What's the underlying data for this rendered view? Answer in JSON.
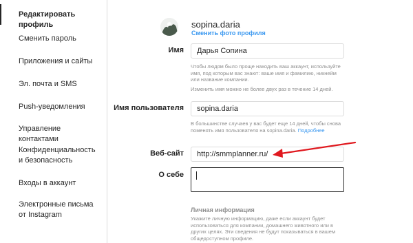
{
  "sidebar": {
    "items": [
      {
        "label": "Редактировать профиль",
        "active": true
      },
      {
        "label": "Сменить пароль"
      },
      {
        "label": "Приложения и сайты"
      },
      {
        "label": "Эл. почта и SMS"
      },
      {
        "label": "Push-уведомления"
      },
      {
        "label": "Управление контактами"
      },
      {
        "label": "Конфиденциальность и безопасность"
      },
      {
        "label": "Входы в аккаунт"
      },
      {
        "label": "Электронные письма от Instagram"
      }
    ]
  },
  "profile": {
    "username": "sopina.daria",
    "change_photo": "Сменить фото профиля"
  },
  "form": {
    "name_label": "Имя",
    "name_value": "Дарья Сопина",
    "name_hint": "Чтобы людям было проще находить ваш аккаунт, используйте имя, под которым вас знают: ваше имя и фамилию, никнейм или название компании.",
    "name_hint2": "Изменить имя можно не более двух раз в течение 14 дней.",
    "username_label": "Имя пользователя",
    "username_value": "sopina.daria",
    "username_hint": "В большинстве случаев у вас будет еще 14 дней, чтобы снова поменять имя пользователя на sopina.daria.",
    "username_hint_link": "Подробнее",
    "website_label": "Веб-сайт",
    "website_value": "http://smmplanner.ru/",
    "bio_label": "О себе",
    "bio_value": ""
  },
  "personal": {
    "title": "Личная информация",
    "hint": "Укажите личную информацию, даже если аккаунт будет использоваться для компании, домашнего животного или в других целях. Эти сведения не будут показываться в вашем общедоступном профиле."
  },
  "colors": {
    "link": "#3897f0",
    "arrow": "#e0191f",
    "border": "#dbdbdb",
    "muted": "#8e8e8e"
  },
  "icons": {
    "avatar": "profile-avatar",
    "arrow": "red-annotation-arrow"
  }
}
